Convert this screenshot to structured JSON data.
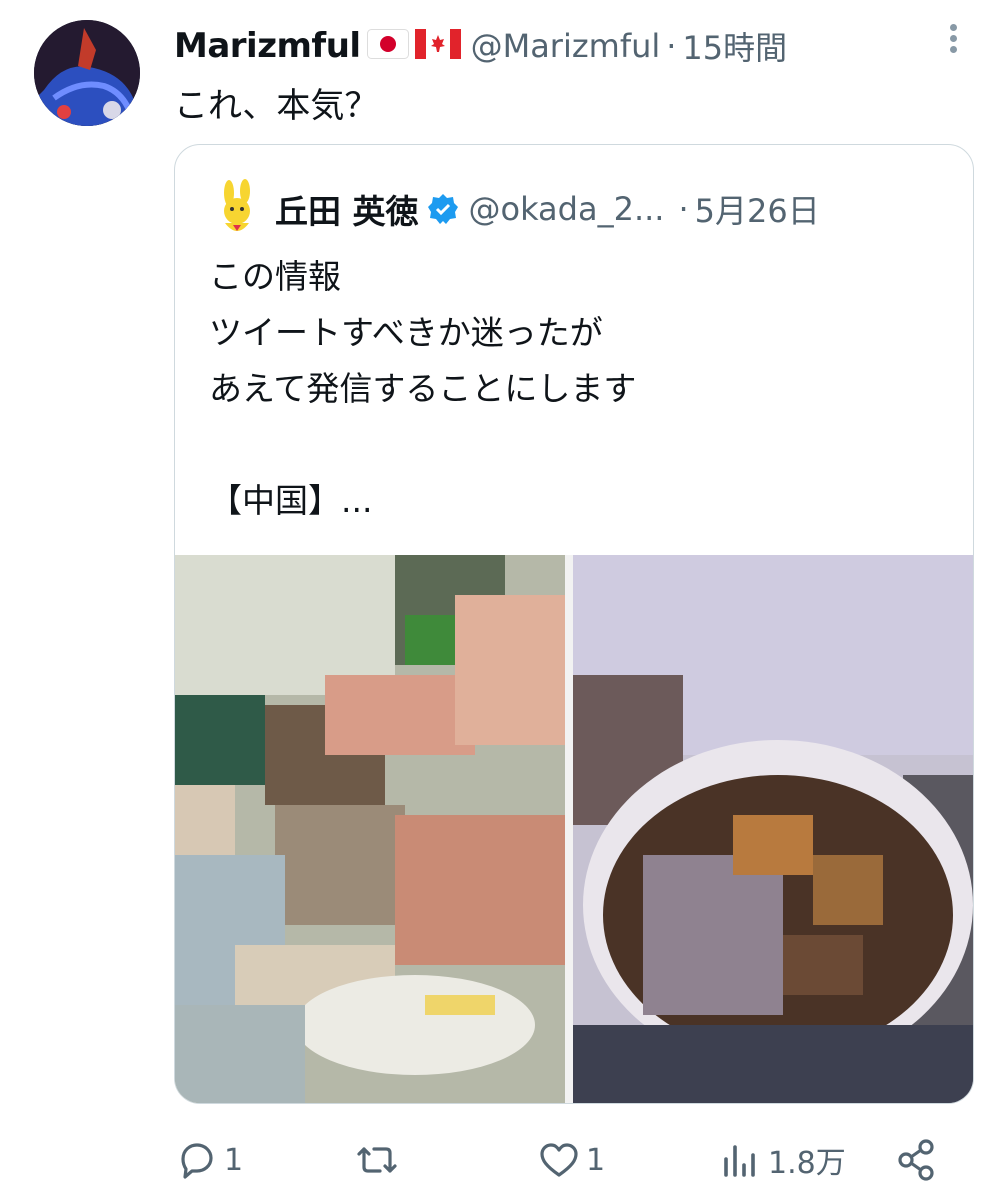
{
  "tweet": {
    "author_name": "Marizmful",
    "author_handle": "@Marizmful",
    "separator": "·",
    "time": "15時間",
    "text": "これ、本気？"
  },
  "quoted": {
    "author_name": "丘田 英徳",
    "author_handle": "@okada_2...",
    "separator": "·",
    "date": "5月26日",
    "lines": [
      "この情報",
      "ツイートすべきか迷ったが",
      "あえて発信することにします",
      "",
      "【中国】..."
    ]
  },
  "actions": {
    "reply_count": "1",
    "retweet_count": "",
    "like_count": "1",
    "views_count": "1.8万"
  },
  "icons": {
    "flags": [
      "japan-flag-icon",
      "canada-flag-icon"
    ],
    "verified": "verified-badge-icon",
    "more": "more-vertical-icon",
    "reply": "reply-icon",
    "retweet": "retweet-icon",
    "like": "heart-icon",
    "views": "views-icon",
    "share": "share-icon"
  },
  "colors": {
    "secondary_text": "#536471",
    "verified_blue": "#1d9bf0",
    "border": "#cfd9de"
  }
}
